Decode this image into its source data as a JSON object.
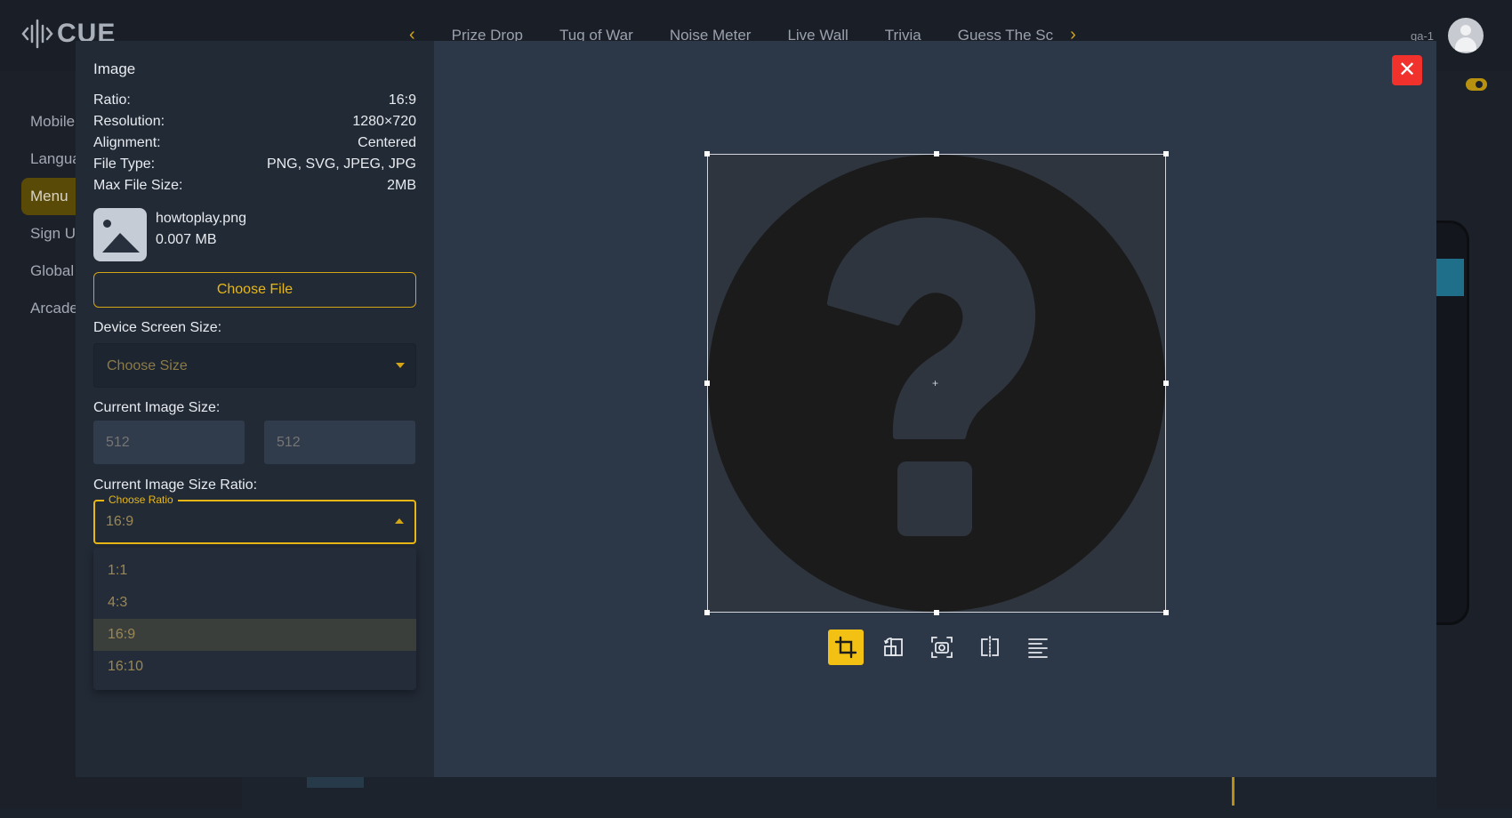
{
  "app": {
    "logo_text": "CUE",
    "user_name": "qa-1"
  },
  "top_nav": {
    "items": [
      "Prize Drop",
      "Tug of War",
      "Noise Meter",
      "Live Wall",
      "Trivia",
      "Guess The Sc"
    ]
  },
  "left_nav": {
    "items": [
      "Mobile",
      "Langua",
      "Menu",
      "Sign U",
      "Global",
      "Arcade"
    ],
    "active_index": 2
  },
  "modal": {
    "section_title": "Image",
    "info": [
      {
        "label": "Ratio:",
        "value": "16:9"
      },
      {
        "label": "Resolution:",
        "value": "1280×720"
      },
      {
        "label": "Alignment:",
        "value": "Centered"
      },
      {
        "label": "File Type:",
        "value": "PNG, SVG, JPEG, JPG"
      },
      {
        "label": "Max File Size:",
        "value": "2MB"
      }
    ],
    "file": {
      "name": "howtoplay.png",
      "size": "0.007 MB"
    },
    "choose_file_label": "Choose File",
    "device_screen_size_label": "Device Screen Size:",
    "device_screen_size_placeholder": "Choose Size",
    "current_image_size_label": "Current Image Size:",
    "width_placeholder": "512",
    "height_placeholder": "512",
    "current_image_ratio_label": "Current Image Size Ratio:",
    "ratio_field_legend": "Choose Ratio",
    "ratio_selected": "16:9",
    "ratio_options": [
      "1:1",
      "4:3",
      "16:9",
      "16:10"
    ],
    "ratio_selected_index": 2,
    "close_label": "✕"
  },
  "editor": {
    "preview_icon": "help-circle-icon",
    "tools": [
      {
        "name": "crop-icon",
        "active": true
      },
      {
        "name": "rotate-icon",
        "active": false
      },
      {
        "name": "screenshot-icon",
        "active": false
      },
      {
        "name": "flip-horizontal-icon",
        "active": false
      },
      {
        "name": "align-left-icon",
        "active": false
      }
    ],
    "accent_color": "#f2c114",
    "close_color": "#f0312c"
  }
}
